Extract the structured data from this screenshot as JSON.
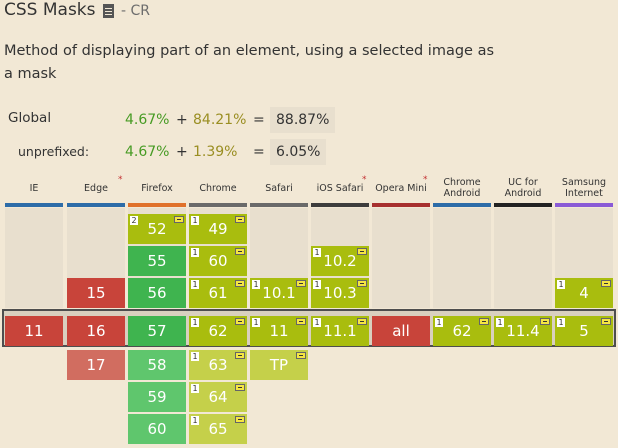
{
  "header": {
    "title": "CSS Masks",
    "status": "- CR",
    "doc_icon": "document-icon"
  },
  "description": "Method of displaying part of an element, using a selected image as a mask",
  "stats": {
    "global": {
      "label": "Global",
      "supported": "4.67%",
      "plus": "+",
      "partial": "84.21%",
      "equals": "=",
      "total": "88.87%"
    },
    "unprefixed": {
      "label": "unprefixed:",
      "supported": "4.67%",
      "plus": "+",
      "partial": "1.39%",
      "equals": "=",
      "total": "6.05%"
    }
  },
  "colors": {
    "supported": "#3fb44f",
    "partial": "#a9bd0e",
    "unsupported": "#c8443a",
    "unsupported_future": "#d16d60",
    "partial_future": "#c5d04a",
    "supported_future": "#5fc66d",
    "bg": "#f2e8d5"
  },
  "browsers": [
    {
      "name": "IE",
      "bar_color": "#2d6ca8",
      "asterisk": false,
      "cells": [
        {
          "label": "11",
          "row": "current",
          "state": "unsupported"
        }
      ]
    },
    {
      "name": "Edge",
      "bar_color": "#2d6ca8",
      "asterisk": true,
      "cells": [
        {
          "label": "15",
          "row": "-1",
          "state": "unsupported"
        },
        {
          "label": "16",
          "row": "current",
          "state": "unsupported"
        },
        {
          "label": "17",
          "row": "+1",
          "state": "unsupported_future"
        }
      ]
    },
    {
      "name": "Firefox",
      "bar_color": "#e0712b",
      "asterisk": false,
      "cells": [
        {
          "label": "52",
          "row": "-4",
          "state": "partial",
          "note": "2",
          "flag": true
        },
        {
          "label": "55",
          "row": "-3",
          "state": "supported"
        },
        {
          "label": "56",
          "row": "-1",
          "state": "supported"
        },
        {
          "label": "57",
          "row": "current",
          "state": "supported"
        },
        {
          "label": "58",
          "row": "+1",
          "state": "supported_future"
        },
        {
          "label": "59",
          "row": "+2",
          "state": "supported_future"
        },
        {
          "label": "60",
          "row": "+3",
          "state": "supported_future"
        }
      ]
    },
    {
      "name": "Chrome",
      "bar_color": "#6a6a6a",
      "asterisk": false,
      "cells": [
        {
          "label": "49",
          "row": "-4",
          "state": "partial",
          "note": "1",
          "flag": true
        },
        {
          "label": "60",
          "row": "-3",
          "state": "partial",
          "note": "1",
          "flag": true
        },
        {
          "label": "61",
          "row": "-1",
          "state": "partial",
          "note": "1",
          "flag": true
        },
        {
          "label": "62",
          "row": "current",
          "state": "partial",
          "note": "1",
          "flag": true
        },
        {
          "label": "63",
          "row": "+1",
          "state": "partial_future",
          "note": "1",
          "flag": true
        },
        {
          "label": "64",
          "row": "+2",
          "state": "partial_future",
          "note": "1",
          "flag": true
        },
        {
          "label": "65",
          "row": "+3",
          "state": "partial_future",
          "note": "1",
          "flag": true
        }
      ]
    },
    {
      "name": "Safari",
      "bar_color": "#6a6a6a",
      "asterisk": false,
      "cells": [
        {
          "label": "10.1",
          "row": "-1",
          "state": "partial",
          "note": "1",
          "flag": true
        },
        {
          "label": "11",
          "row": "current",
          "state": "partial",
          "note": "1",
          "flag": true
        },
        {
          "label": "TP",
          "row": "+1",
          "state": "partial_future",
          "flag": true
        }
      ]
    },
    {
      "name": "iOS Safari",
      "bar_color": "#3d3d3d",
      "asterisk": true,
      "cells": [
        {
          "label": "10.2",
          "row": "-2",
          "state": "partial",
          "note": "1",
          "flag": true
        },
        {
          "label": "10.3",
          "row": "-1",
          "state": "partial",
          "note": "1",
          "flag": true
        },
        {
          "label": "11.1",
          "row": "current",
          "state": "partial",
          "note": "1",
          "flag": true
        }
      ]
    },
    {
      "name": "Opera Mini",
      "bar_color": "#a7302f",
      "asterisk": true,
      "cells": [
        {
          "label": "all",
          "row": "current",
          "state": "unsupported"
        }
      ]
    },
    {
      "name": "Chrome Android",
      "bar_color": "#2d6ca8",
      "asterisk": false,
      "cells": [
        {
          "label": "62",
          "row": "current",
          "state": "partial",
          "note": "1",
          "flag": true
        }
      ]
    },
    {
      "name": "UC for Android",
      "bar_color": "#222222",
      "asterisk": false,
      "cells": [
        {
          "label": "11.4",
          "row": "current",
          "state": "partial",
          "note": "1",
          "flag": true
        }
      ]
    },
    {
      "name": "Samsung Internet",
      "bar_color": "#8a5ad6",
      "asterisk": false,
      "cells": [
        {
          "label": "4",
          "row": "-1",
          "state": "partial",
          "note": "1",
          "flag": true
        },
        {
          "label": "5",
          "row": "current",
          "state": "partial",
          "note": "1",
          "flag": true
        }
      ]
    }
  ]
}
